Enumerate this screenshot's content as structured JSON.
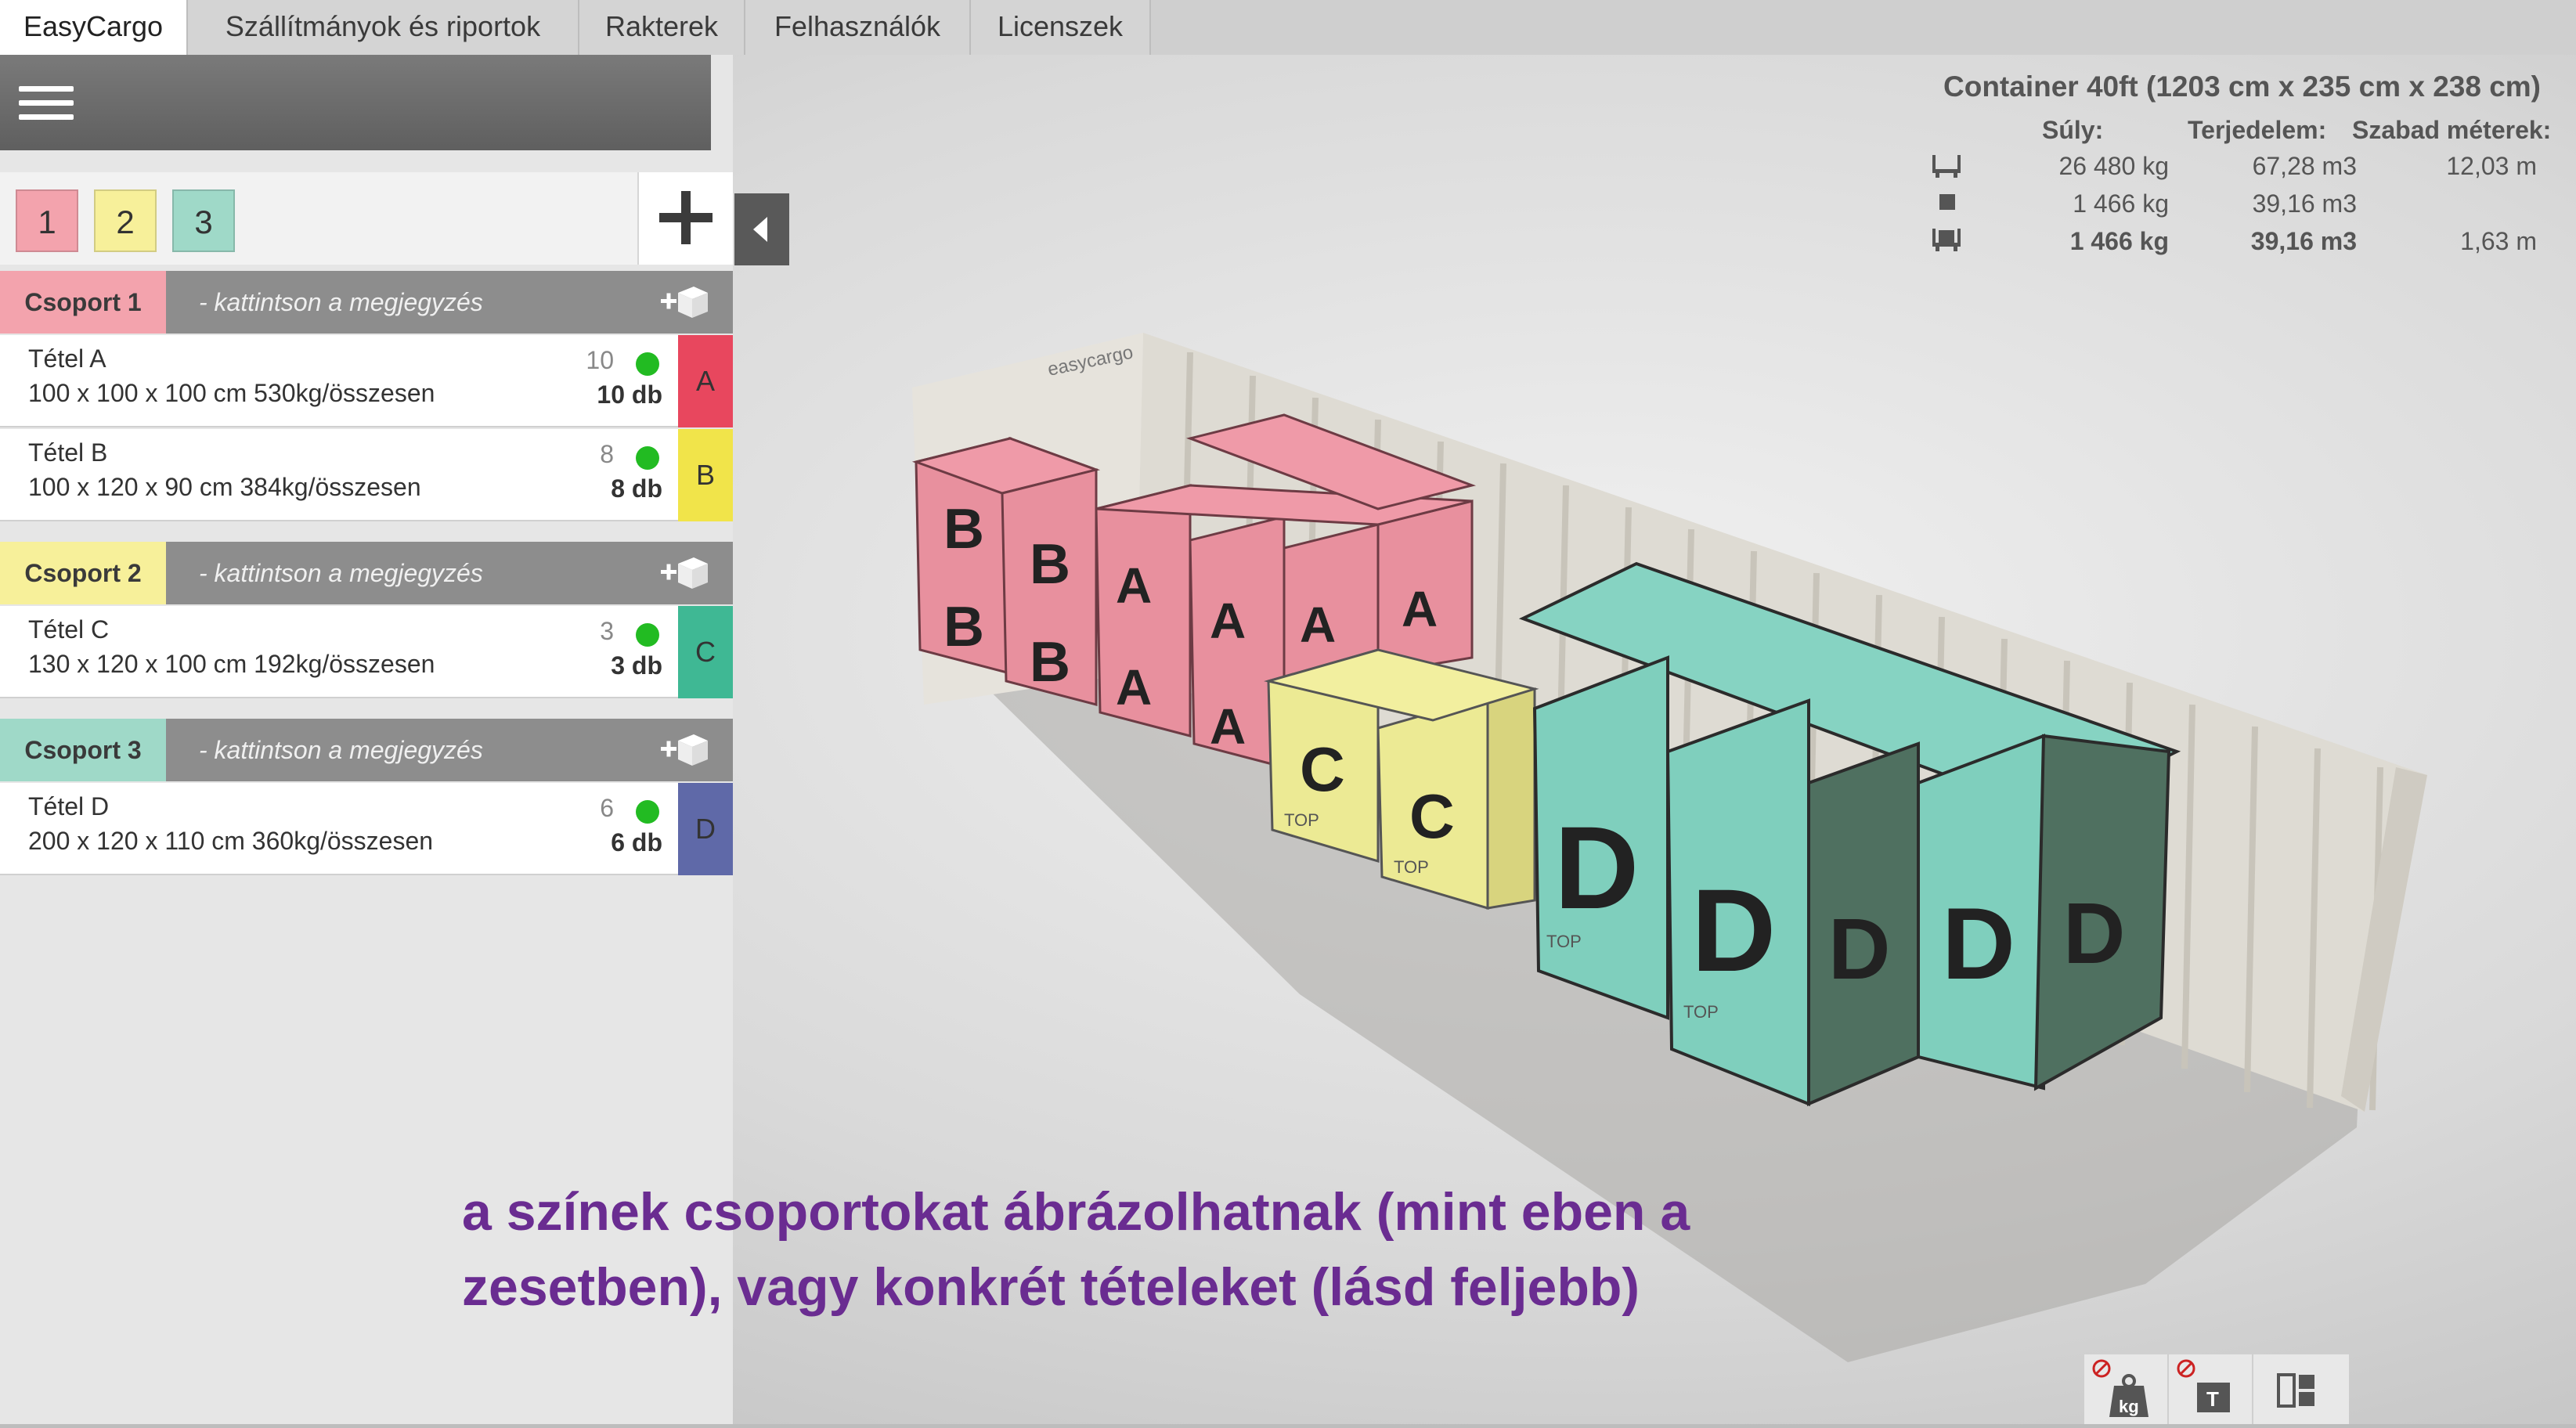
{
  "tabs": [
    {
      "label": "EasyCargo",
      "active": true
    },
    {
      "label": "Szállítmányok és riportok",
      "active": false
    },
    {
      "label": "Rakterek",
      "active": false
    },
    {
      "label": "Felhasználók",
      "active": false
    },
    {
      "label": "Licenszek",
      "active": false
    }
  ],
  "sidebar": {
    "group_buttons": [
      {
        "label": "1",
        "color": "#f3a3ad"
      },
      {
        "label": "2",
        "color": "#f7f09a"
      },
      {
        "label": "3",
        "color": "#9fd9c8"
      }
    ],
    "groups": [
      {
        "label": "Csoport 1",
        "color": "#f3a3ad",
        "note": "- kattintson a megjegyzés",
        "items": [
          {
            "name": "Tétel A",
            "dims": "100 x 100 x 100 cm 530kg/összesen",
            "count": "10",
            "qty": "10  db",
            "letter": "A",
            "color": "#e8475e"
          },
          {
            "name": "Tétel B",
            "dims": "100 x 120 x 90 cm 384kg/összesen",
            "count": "8",
            "qty": "8  db",
            "letter": "B",
            "color": "#f1e44a"
          }
        ]
      },
      {
        "label": "Csoport 2",
        "color": "#f7f09a",
        "note": "- kattintson a megjegyzés",
        "items": [
          {
            "name": "Tétel C",
            "dims": "130 x 120 x 100 cm 192kg/összesen",
            "count": "3",
            "qty": "3  db",
            "letter": "C",
            "color": "#3fb894"
          }
        ]
      },
      {
        "label": "Csoport 3",
        "color": "#9fd9c8",
        "note": "- kattintson a megjegyzés",
        "items": [
          {
            "name": "Tétel D",
            "dims": "200 x 120 x 110 cm 360kg/összesen",
            "count": "6",
            "qty": "6  db",
            "letter": "D",
            "color": "#5f69a8"
          }
        ]
      }
    ]
  },
  "info": {
    "title": "Container 40ft (1203 cm x 235 cm x 238 cm)",
    "headers": {
      "weight": "Súly:",
      "volume": "Terjedelem:",
      "free": "Szabad méterek:"
    },
    "rows": [
      {
        "icon": "pallet-capacity-icon",
        "weight": "26 480 kg",
        "volume": "67,28 m3",
        "free": "12,03 m",
        "bold": false
      },
      {
        "icon": "cargo-box-icon",
        "weight": "1 466 kg",
        "volume": "39,16 m3",
        "free": "",
        "bold": false
      },
      {
        "icon": "loaded-pallet-icon",
        "weight": "1 466 kg",
        "volume": "39,16 m3",
        "free": "1,63 m",
        "bold": true
      }
    ]
  },
  "container_logo": "easycargo",
  "box_label_top": "TOP",
  "caption": {
    "line1": "a színek csoportokat ábrázolhatnak (mint eben a",
    "line2": "zesetben), vagy konkrét tételeket (lásd feljebb)"
  },
  "box_colors": {
    "A": "#e8909e",
    "B": "#e8909e",
    "C": "#ecea94",
    "D": "#7fcfbd"
  },
  "toolbar": {
    "buttons": [
      "weight-toggle-icon",
      "label-toggle-icon",
      "layout-view-icon"
    ],
    "weight_unit": "kg",
    "label_glyph": "T"
  }
}
